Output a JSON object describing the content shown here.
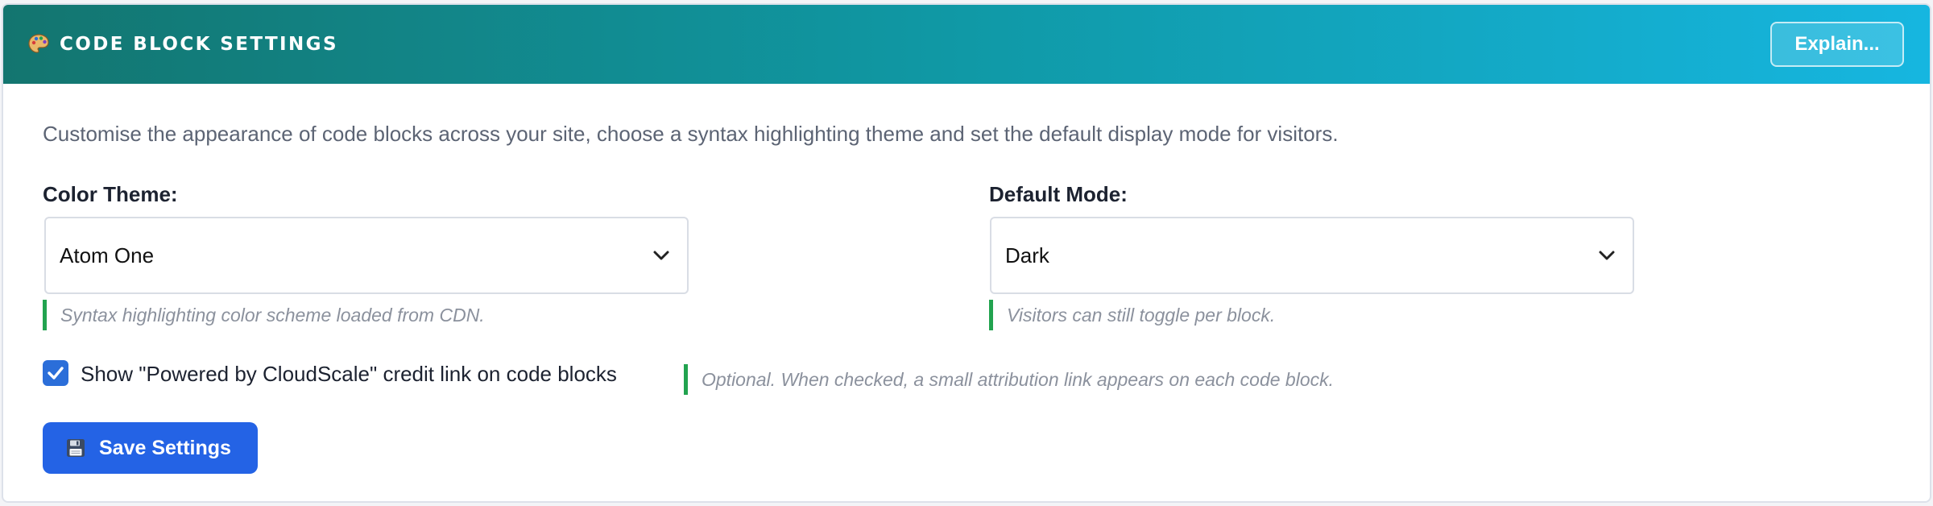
{
  "header": {
    "icon": "palette-icon",
    "title": "CODE BLOCK SETTINGS",
    "explain_label": "Explain..."
  },
  "intro": "Customise the appearance of code blocks across your site, choose a syntax highlighting theme and set the default display mode for visitors.",
  "color_theme": {
    "label": "Color Theme:",
    "value": "Atom One",
    "hint": "Syntax highlighting color scheme loaded from CDN."
  },
  "default_mode": {
    "label": "Default Mode:",
    "value": "Dark",
    "hint": "Visitors can still toggle per block."
  },
  "credit": {
    "checked": true,
    "label": "Show \"Powered by CloudScale\" credit link on code blocks",
    "hint": "Optional. When checked, a small attribution link appears on each code block."
  },
  "save": {
    "icon": "floppy-disk-icon",
    "label": "Save Settings"
  },
  "colors": {
    "header_start": "#13756f",
    "header_end": "#16b6e0",
    "accent_green": "#22a34f",
    "primary_blue": "#2463e5",
    "checkbox_blue": "#2b6ed9"
  }
}
